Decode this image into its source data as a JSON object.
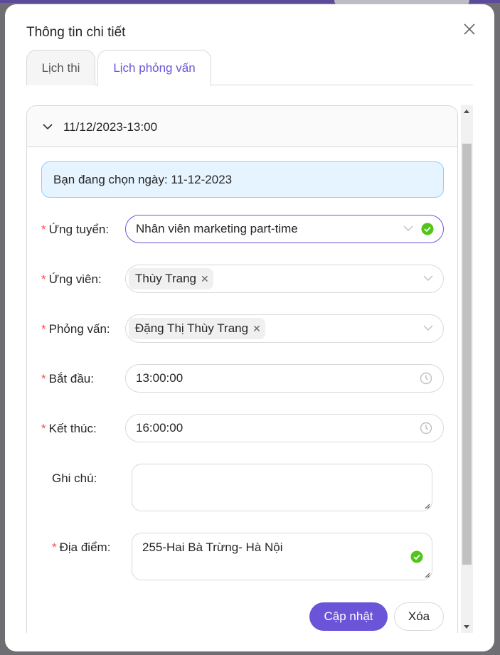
{
  "modal": {
    "title": "Thông tin chi tiết"
  },
  "tabs": [
    {
      "label": "Lịch thi",
      "active": false
    },
    {
      "label": "Lịch phỏng vấn",
      "active": true
    }
  ],
  "panel": {
    "title": "11/12/2023-13:00",
    "alert": "Bạn đang chọn ngày: 11-12-2023",
    "fields": {
      "position": {
        "label": "Ứng tuyển",
        "value": "Nhân viên marketing part-time"
      },
      "candidate": {
        "label": "Ứng viên",
        "tag": "Thùy Trang"
      },
      "interviewer": {
        "label": "Phỏng vấn",
        "tag": "Đặng Thị Thùy Trang"
      },
      "start": {
        "label": "Bắt đầu",
        "value": "13:00:00"
      },
      "end": {
        "label": "Kết thúc",
        "value": "16:00:00"
      },
      "note": {
        "label": "Ghi chú",
        "value": ""
      },
      "location": {
        "label": "Địa điểm",
        "value": "255-Hai Bà Trừng- Hà Nội"
      }
    },
    "required_mark": "*",
    "label_suffix": ":"
  },
  "buttons": {
    "update": "Cập nhật",
    "delete": "Xóa"
  },
  "colors": {
    "primary": "#6c54d8",
    "success": "#52c41a",
    "alert_bg": "#e6f4ff",
    "required": "#ff4d4f"
  }
}
